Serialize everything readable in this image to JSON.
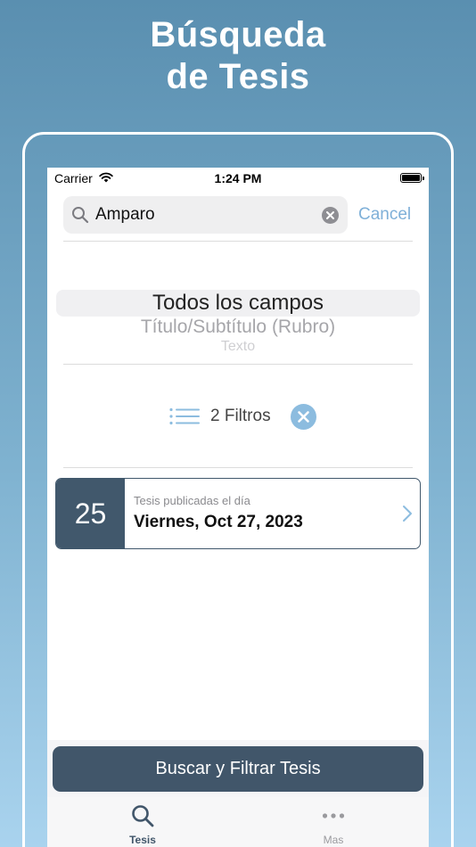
{
  "promo": {
    "title_line1": "Búsqueda",
    "title_line2": "de Tesis"
  },
  "status_bar": {
    "carrier": "Carrier",
    "time": "1:24 PM"
  },
  "search": {
    "value": "Amparo",
    "cancel_label": "Cancel"
  },
  "picker": {
    "options": [
      "Todos los campos",
      "Título/Subtítulo (Rubro)",
      "Texto"
    ],
    "selected_index": 0
  },
  "filters": {
    "label": "2 Filtros",
    "count": 2
  },
  "date_card": {
    "day": "25",
    "caption": "Tesis publicadas el día",
    "date": "Viernes, Oct 27, 2023"
  },
  "primary_button": {
    "label": "Buscar y Filtrar Tesis"
  },
  "tab_bar": {
    "tabs": [
      {
        "label": "Tesis",
        "icon": "search-icon",
        "active": true
      },
      {
        "label": "Mas",
        "icon": "more-icon",
        "active": false
      }
    ]
  },
  "colors": {
    "accent": "#41566a",
    "link": "#7fb0d8",
    "background_top": "#5a8fb0",
    "background_bottom": "#a9d3ee"
  }
}
